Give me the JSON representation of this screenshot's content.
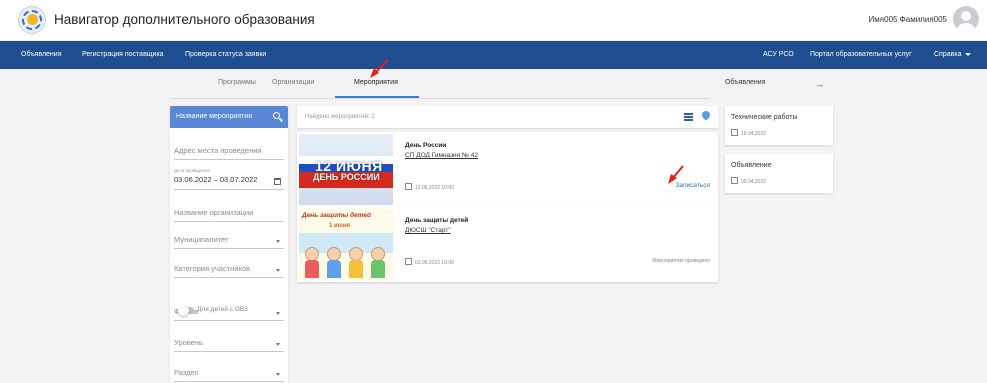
{
  "header": {
    "title": "Навигатор дополнительного образования",
    "username": "Имя005 Фамилия005",
    "logo_icon": "sun-logo-icon",
    "avatar_icon": "user-avatar-icon"
  },
  "navbar": {
    "left_items": [
      "Объявления",
      "Регистрация поставщика",
      "Проверка статуса заявки"
    ],
    "right_items": [
      "АСУ РСО",
      "Портал образовательных услуг",
      "Справка"
    ],
    "colors": {
      "background": "#1e4e90",
      "text": "#ffffff"
    }
  },
  "tabs": {
    "items": [
      "Программы",
      "Организации",
      "Мероприятия"
    ],
    "active": "Мероприятия",
    "accent_color": "#3a7bd5"
  },
  "filters": {
    "search_label": "Название мероприятия",
    "address_placeholder": "Адрес места проведения",
    "date_label": "Дата проведения",
    "date_value": "03.06.2022 – 03.07.2022",
    "org_placeholder": "Название организации",
    "municipality_placeholder": "Муниципалитет",
    "category_placeholder": "Категория участников",
    "toggle_label": "Для детей с ОВЗ",
    "toggle_on": false,
    "form_placeholder": "Форма",
    "level_placeholder": "Уровень",
    "section_placeholder": "Раздел"
  },
  "results": {
    "found_text": "Найдено мероприятий: 2",
    "view_list_icon": "list-view-icon",
    "view_map_icon": "map-pin-icon"
  },
  "events": [
    {
      "title": "День России",
      "organization": "СП ДОД Гимназия № 42",
      "date": "12.06.2022 10:00",
      "action": "Записаться",
      "banner_line1": "12 ИЮНЯ",
      "banner_line2": "ДЕНЬ РОССИИ"
    },
    {
      "title": "День защиты детей",
      "organization": "ДЮСШ \"Старт\"",
      "date": "03.06.2022 10:00",
      "status": "Мероприятие проведено",
      "banner_line1": "День защиты детей",
      "banner_line2": "1 июня"
    }
  ],
  "announcements": {
    "header": "Объявления",
    "arrow_icon": "arrow-right-icon",
    "items": [
      {
        "title": "Технические работы",
        "date": "18.04.2022"
      },
      {
        "title": "Объявление",
        "date": "05.04.2022"
      }
    ]
  },
  "annotation_color": "#e0221b"
}
